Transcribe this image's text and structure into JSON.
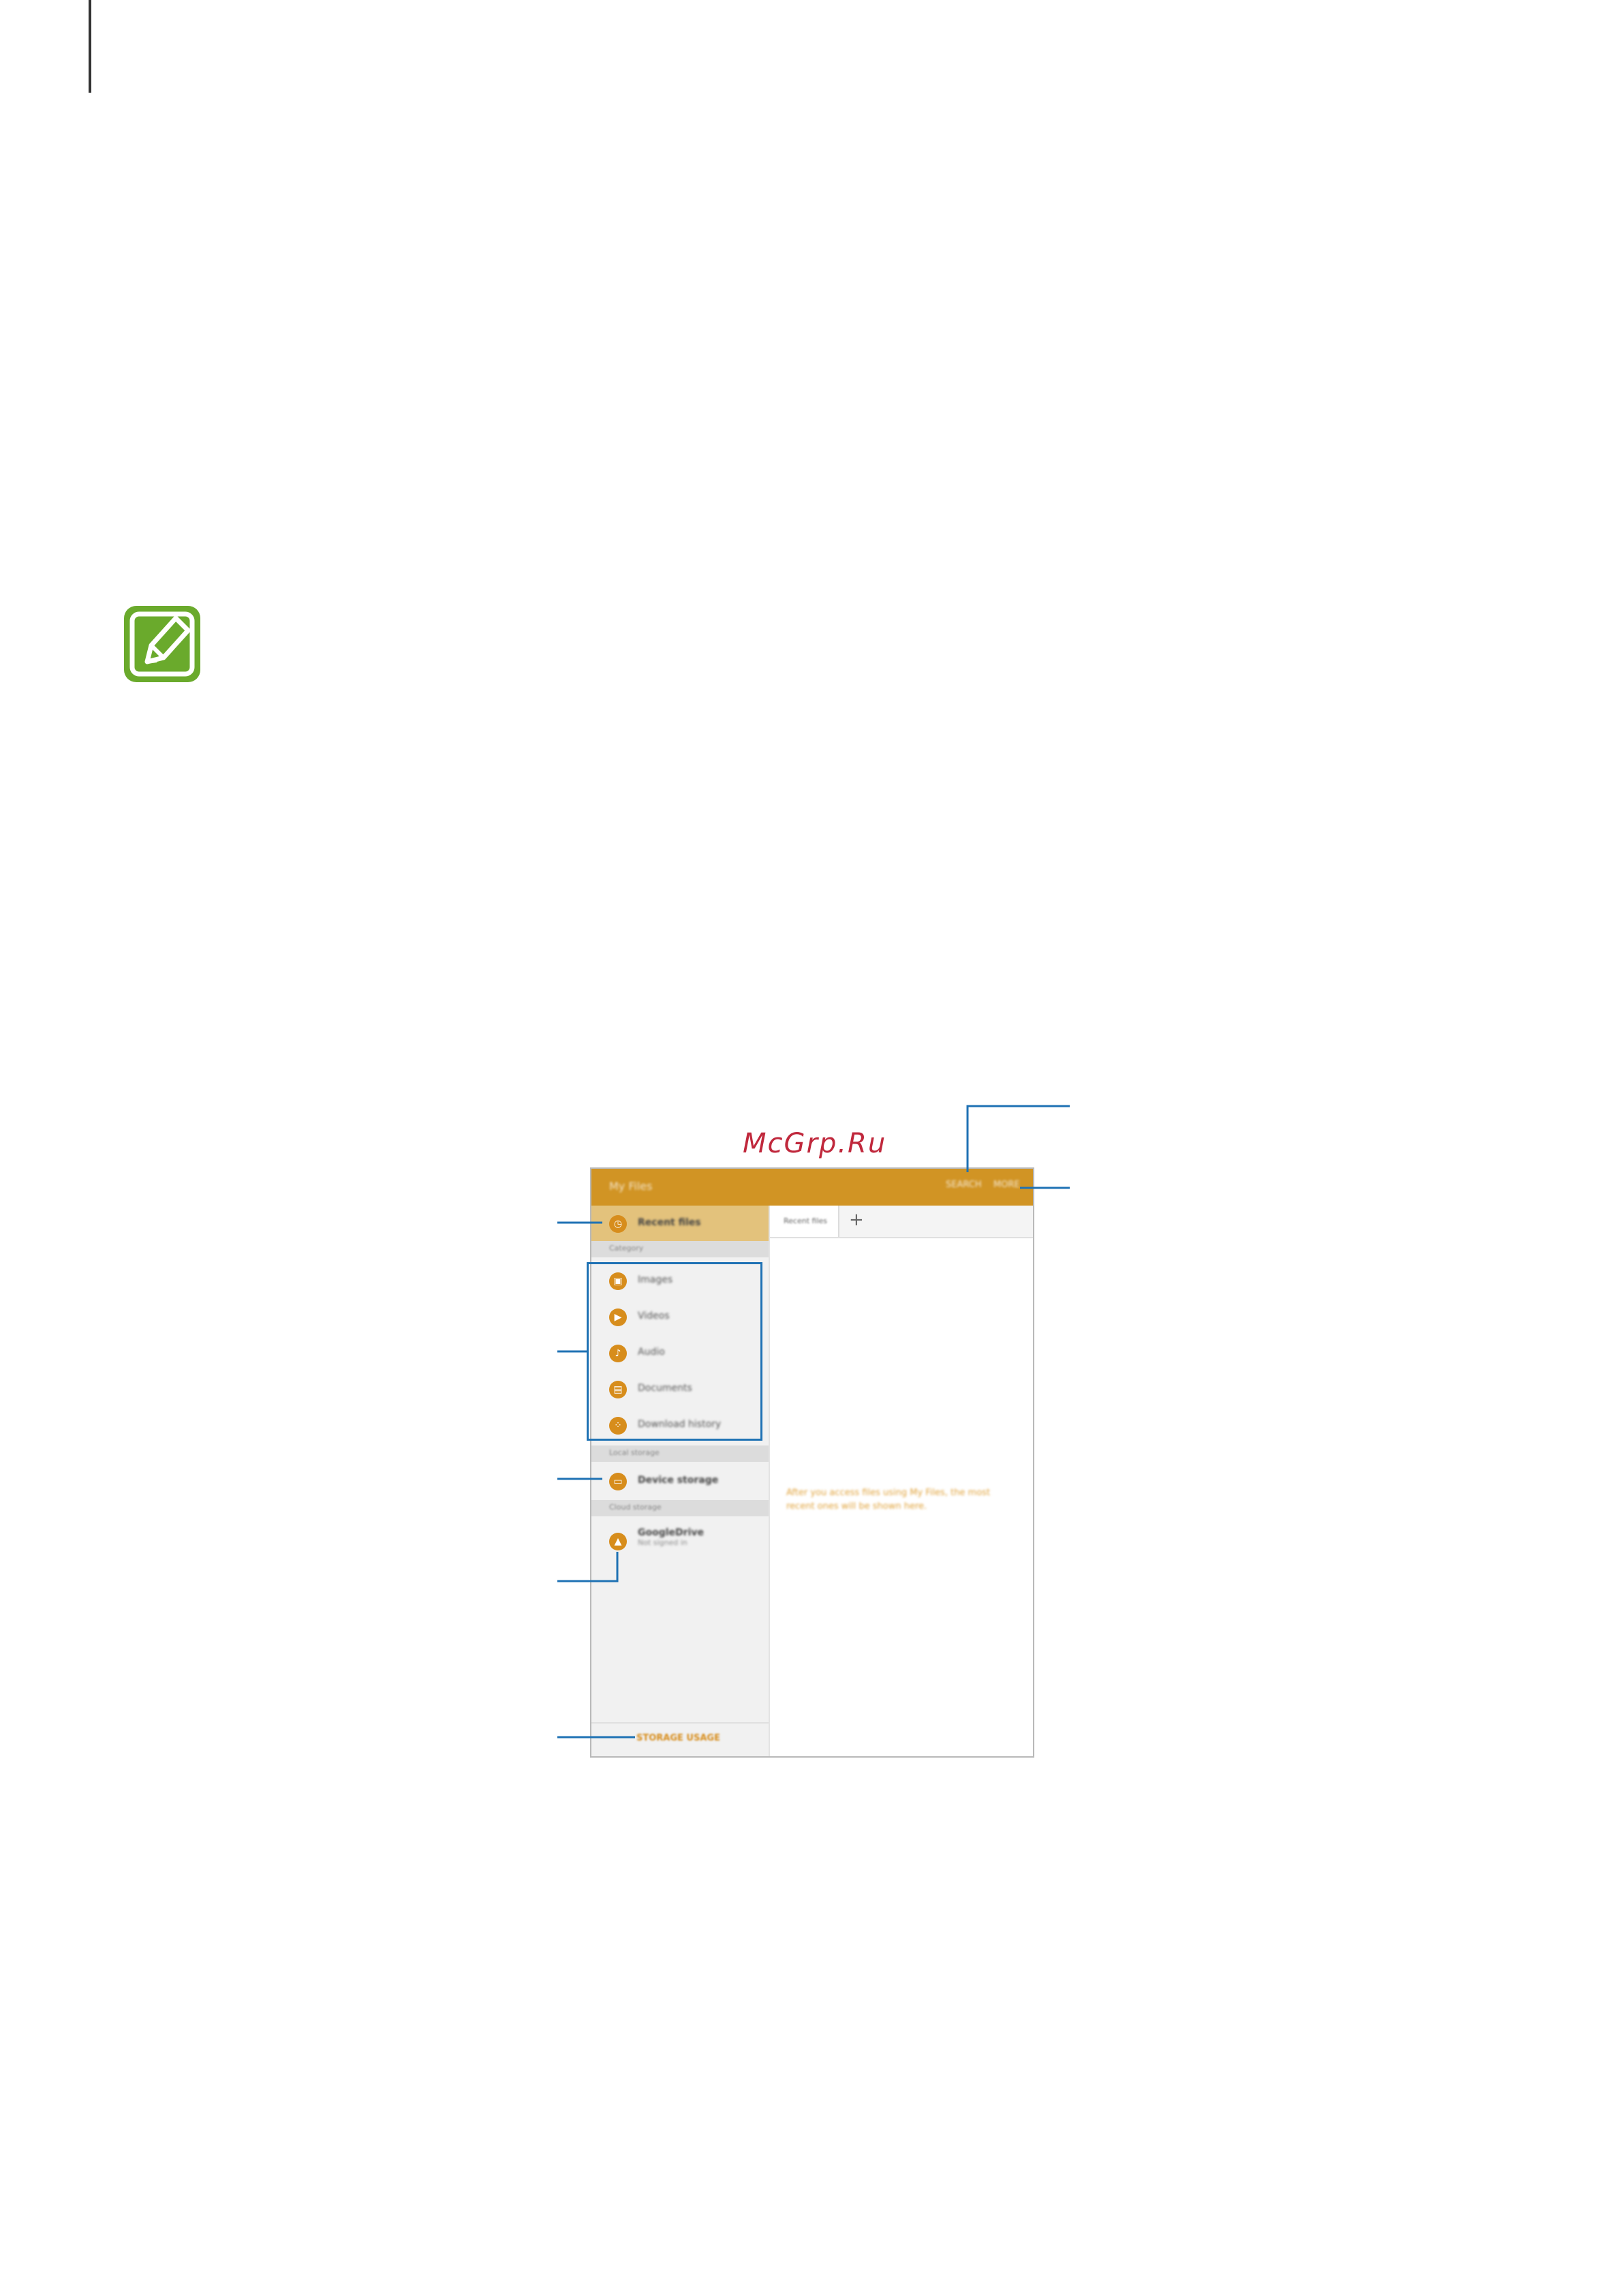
{
  "watermark": "McGrp.Ru",
  "screen": {
    "appbar": {
      "title": "My Files",
      "search_label": "SEARCH",
      "more_label": "MORE"
    },
    "sidebar": {
      "recent": {
        "label": "Recent files",
        "icon": "clock-icon"
      },
      "categories_header": "Category",
      "categories": [
        {
          "label": "Images",
          "icon": "image-icon",
          "glyph": "▣"
        },
        {
          "label": "Videos",
          "icon": "video-icon",
          "glyph": "▶"
        },
        {
          "label": "Audio",
          "icon": "music-note-icon",
          "glyph": "♪"
        },
        {
          "label": "Documents",
          "icon": "document-icon",
          "glyph": "▤"
        },
        {
          "label": "Download history",
          "icon": "download-icon",
          "glyph": "⁘"
        }
      ],
      "local_header": "Local storage",
      "device_storage": {
        "label": "Device storage",
        "icon": "device-storage-icon",
        "glyph": "▭"
      },
      "cloud_header": "Cloud storage",
      "cloud": {
        "label": "GoogleDrive",
        "sublabel": "Not signed in",
        "icon": "cloud-drive-icon",
        "glyph": "▲"
      },
      "storage_usage": "STORAGE USAGE"
    },
    "tabs": {
      "active": "Recent files",
      "add_glyph": "+"
    },
    "empty_message": "After you access files using My Files, the most recent ones will be shown here."
  },
  "colors": {
    "appbar": "#d19424",
    "accent": "#d78d1c",
    "callout": "#1f72b4",
    "note_icon": "#6aaa2c",
    "watermark": "#c0283c"
  }
}
